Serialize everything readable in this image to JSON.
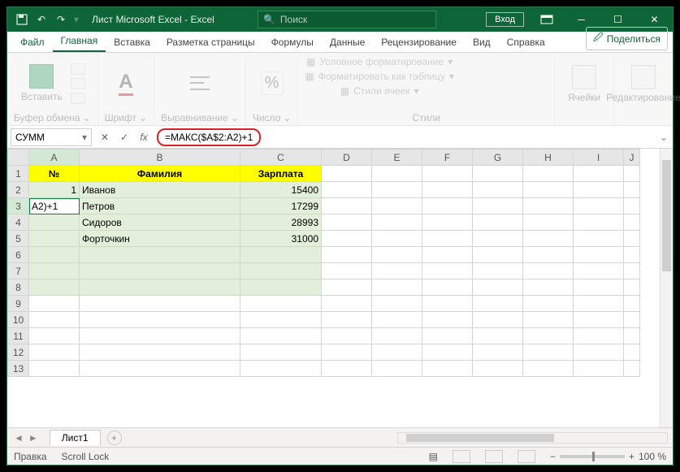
{
  "titlebar": {
    "title": "Лист Microsoft Excel  -  Excel",
    "search_placeholder": "Поиск",
    "login": "Вход"
  },
  "tabs": {
    "file": "Файл",
    "home": "Главная",
    "insert": "Вставка",
    "layout": "Разметка страницы",
    "formulas": "Формулы",
    "data": "Данные",
    "review": "Рецензирование",
    "view": "Вид",
    "help": "Справка",
    "share": "Поделиться"
  },
  "ribbon": {
    "clipboard": {
      "paste": "Вставить",
      "label": "Буфер обмена"
    },
    "font": {
      "label": "Шрифт"
    },
    "align": {
      "label": "Выравнивание"
    },
    "number": {
      "label": "Число"
    },
    "styles": {
      "cond": "Условное форматирование",
      "table": "Форматировать как таблицу",
      "cell": "Стили ячеек",
      "label": "Стили"
    },
    "cells": {
      "label": "Ячейки"
    },
    "edit": {
      "label": "Редактирование"
    }
  },
  "ribbon2": "Буфер обмена",
  "formulabar": {
    "namebox": "СУММ",
    "fx": "fx",
    "formula": "=МАКС($A$2:A2)+1"
  },
  "columns": [
    "A",
    "B",
    "C",
    "D",
    "E",
    "F",
    "G",
    "H",
    "I",
    "J"
  ],
  "rows": [
    "1",
    "2",
    "3",
    "4",
    "5",
    "6",
    "7",
    "8",
    "9",
    "10",
    "11",
    "12",
    "13"
  ],
  "headers": {
    "a": "№",
    "b": "Фамилия",
    "c": "Зарплата"
  },
  "data": {
    "r2": {
      "a": "1",
      "b": "Иванов",
      "c": "15400"
    },
    "r3": {
      "a": "A2)+1",
      "b": "Петров",
      "c": "17299"
    },
    "r4": {
      "a": "",
      "b": "Сидоров",
      "c": "28993"
    },
    "r5": {
      "a": "",
      "b": "Форточкин",
      "c": "31000"
    }
  },
  "sheet": {
    "name": "Лист1"
  },
  "status": {
    "mode": "Правка",
    "scroll": "Scroll Lock",
    "zoom": "100 %"
  }
}
